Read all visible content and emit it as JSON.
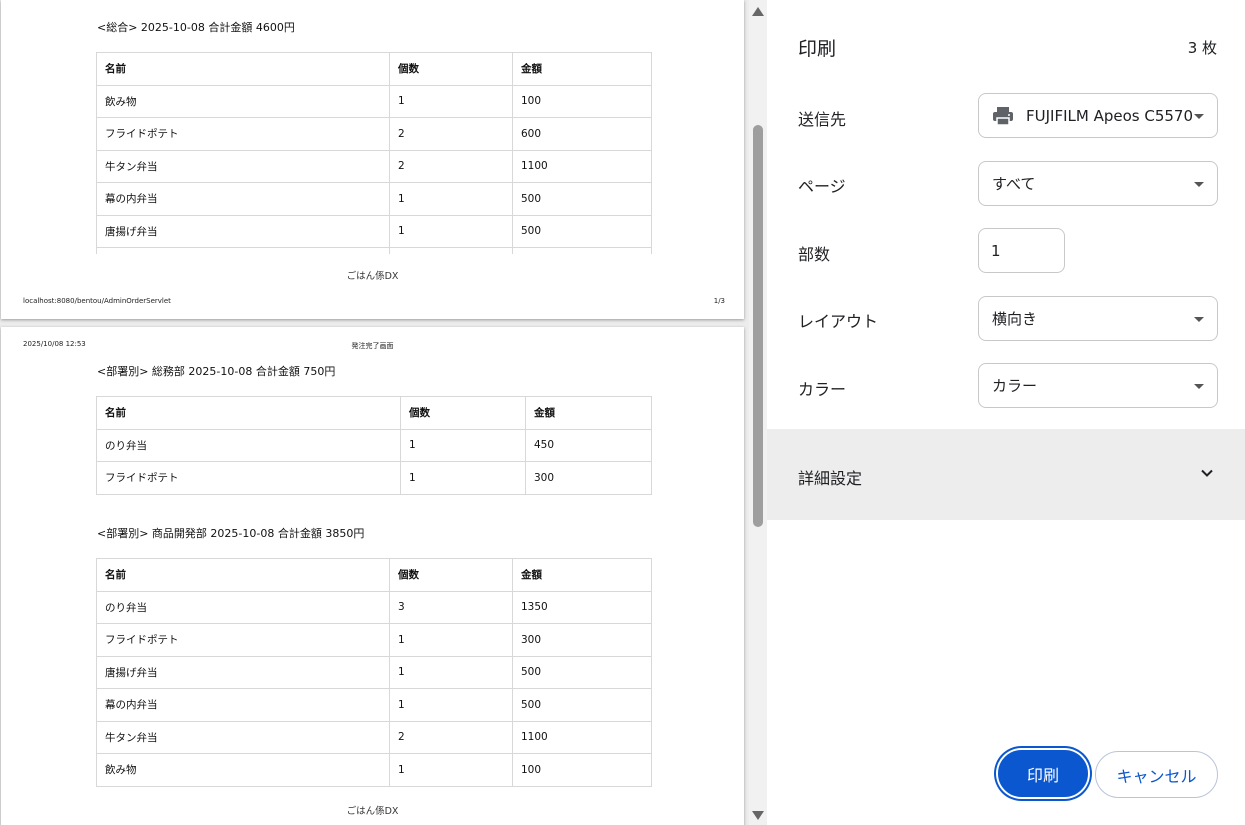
{
  "preview": {
    "page1": {
      "section": {
        "title": "<総合> 2025-10-08 合計金額 4600円",
        "headers": [
          "名前",
          "個数",
          "金額"
        ],
        "rows": [
          [
            "飲み物",
            "1",
            "100"
          ],
          [
            "フライドポテト",
            "2",
            "600"
          ],
          [
            "牛タン弁当",
            "2",
            "1100"
          ],
          [
            "幕の内弁当",
            "1",
            "500"
          ],
          [
            "唐揚げ弁当",
            "1",
            "500"
          ]
        ]
      },
      "footer_center": "ごはん係DX",
      "footer_url": "localhost:8080/bentou/AdminOrderServlet",
      "footer_page": "1/3"
    },
    "page2": {
      "header_date": "2025/10/08 12:53",
      "header_title": "発注完了画面",
      "sections": [
        {
          "title": "<部署別> 総務部 2025-10-08 合計金額 750円",
          "headers": [
            "名前",
            "個数",
            "金額"
          ],
          "rows": [
            [
              "のり弁当",
              "1",
              "450"
            ],
            [
              "フライドポテト",
              "1",
              "300"
            ]
          ]
        },
        {
          "title": "<部署別> 商品開発部 2025-10-08 合計金額 3850円",
          "headers": [
            "名前",
            "個数",
            "金額"
          ],
          "rows": [
            [
              "のり弁当",
              "3",
              "1350"
            ],
            [
              "フライドポテト",
              "1",
              "300"
            ],
            [
              "唐揚げ弁当",
              "1",
              "500"
            ],
            [
              "幕の内弁当",
              "1",
              "500"
            ],
            [
              "牛タン弁当",
              "2",
              "1100"
            ],
            [
              "飲み物",
              "1",
              "100"
            ]
          ]
        }
      ],
      "footer_center": "ごはん係DX"
    }
  },
  "panel": {
    "title": "印刷",
    "sheet_count": "3 枚",
    "destination_label": "送信先",
    "destination_value": "FUJIFILM Apeos C5570",
    "pages_label": "ページ",
    "pages_value": "すべて",
    "copies_label": "部数",
    "copies_value": "1",
    "layout_label": "レイアウト",
    "layout_value": "横向き",
    "color_label": "カラー",
    "color_value": "カラー",
    "advanced_label": "詳細設定",
    "print_button": "印刷",
    "cancel_button": "キャンセル"
  },
  "colors": {
    "accent": "#0b57d0",
    "advanced_bg": "#ededed",
    "preview_bg": "#ececec"
  },
  "icons": [
    "printer-icon",
    "chevron-down-icon",
    "scroll-up-arrow-icon",
    "scroll-down-arrow-icon"
  ]
}
